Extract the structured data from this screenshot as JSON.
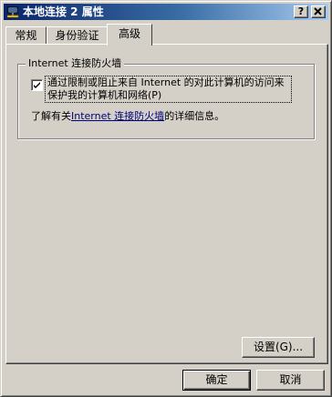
{
  "window": {
    "title": "本地连接 2 属性",
    "help_button": "?",
    "close_button": "X"
  },
  "tabs": [
    {
      "label": "常规",
      "active": false
    },
    {
      "label": "身份验证",
      "active": false
    },
    {
      "label": "高级",
      "active": true
    }
  ],
  "firewall": {
    "group_title": "Internet 连接防火墙",
    "checkbox_label": "通过限制或阻止来自 Internet 的对此计算机的访问来保护我的计算机和网络(P)",
    "checkbox_checked": true,
    "info_prefix": "了解有关",
    "info_link": "Internet 连接防火墙",
    "info_suffix": "的详细信息。"
  },
  "buttons": {
    "settings": "设置(G)...",
    "ok": "确定",
    "cancel": "取消"
  },
  "icons": {
    "title_icon": "network-connection-icon",
    "check": "checkmark-icon"
  }
}
